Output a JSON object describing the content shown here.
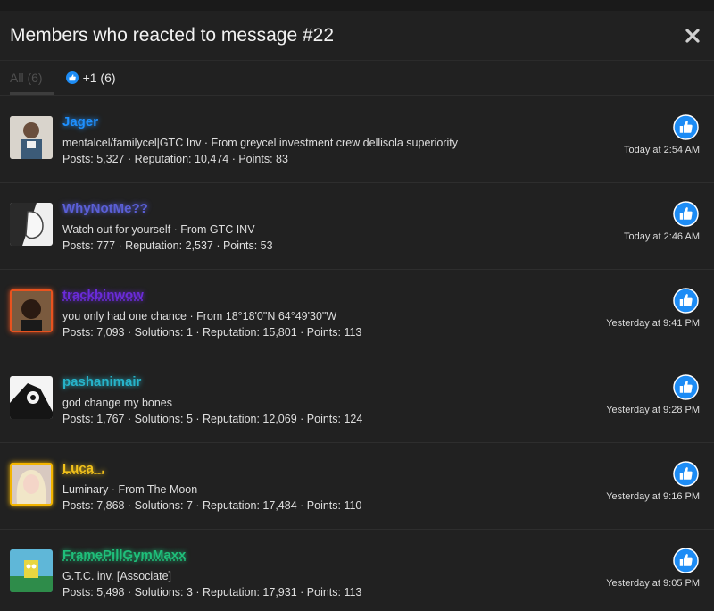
{
  "dialog": {
    "title": "Members who reacted to message #22",
    "close_icon": "close-icon"
  },
  "tabs": [
    {
      "label": "All (6)"
    },
    {
      "label": "+1 (6)",
      "icon": "thumbs-up-icon"
    }
  ],
  "members": [
    {
      "name": "Jager",
      "name_color": "#1e90ff",
      "tagline": "mentalcel/familycel|GTC Inv · From greycel investment crew dellisola superiority",
      "stats": "Posts: 5,327 · Reputation: 10,474 · Points: 83",
      "time": "Today at 2:54 AM",
      "reaction_icon": "thumbs-up-icon"
    },
    {
      "name": "WhyNotMe??",
      "name_color": "#5a5fd6",
      "tagline": "Watch out for yourself · From GTC INV",
      "stats": "Posts: 777 · Reputation: 2,537 · Points: 53",
      "time": "Today at 2:46 AM",
      "reaction_icon": "thumbs-up-icon"
    },
    {
      "name": "trackbinwow",
      "name_color": "#6a2bd8",
      "tagline": "you only had one chance · From 18°18'0\"N 64°49'30\"W",
      "stats": "Posts: 7,093 · Solutions: 1 · Reputation: 15,801 · Points: 113",
      "time": "Yesterday at 9:41 PM",
      "reaction_icon": "thumbs-up-icon",
      "ring_color": "#e8531f"
    },
    {
      "name": "pashanimair",
      "name_color": "#27b3c9",
      "tagline": "god change my bones",
      "stats": "Posts: 1,767 · Solutions: 5 · Reputation: 12,069 · Points: 124",
      "time": "Yesterday at 9:28 PM",
      "reaction_icon": "thumbs-up-icon"
    },
    {
      "name": "Luca_.",
      "name_color": "#f2c21b",
      "tagline": "Luminary · From The Moon",
      "stats": "Posts: 7,868 · Solutions: 7 · Reputation: 17,484 · Points: 110",
      "time": "Yesterday at 9:16 PM",
      "reaction_icon": "thumbs-up-icon",
      "ring_color": "#f2b400"
    },
    {
      "name": "FramePillGymMaxx",
      "name_color": "#1fbf7a",
      "tagline": "G.T.C. inv. [Associate]",
      "stats": "Posts: 5,498 · Solutions: 3 · Reputation: 17,931 · Points: 113",
      "time": "Yesterday at 9:05 PM",
      "reaction_icon": "thumbs-up-icon"
    }
  ]
}
